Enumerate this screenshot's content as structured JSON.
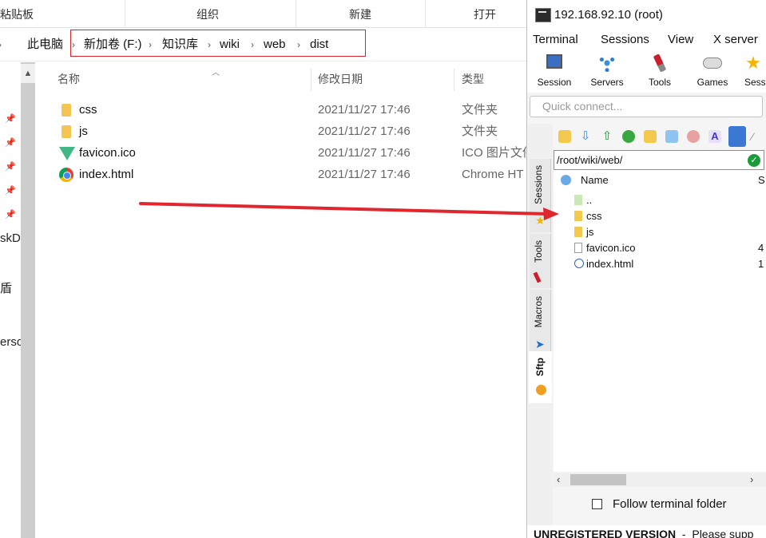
{
  "explorer": {
    "ribbon": {
      "groups": [
        "粘贴板",
        "组织",
        "新建",
        "打开"
      ]
    },
    "breadcrumb": {
      "items": [
        "此电脑",
        "新加卷 (F:)",
        "知识库",
        "wiki",
        "web",
        "dist"
      ]
    },
    "nav_fragments": [
      "skDe",
      "盾",
      "erso"
    ],
    "columns": {
      "name": "名称",
      "modified": "修改日期",
      "type": "类型"
    },
    "files": [
      {
        "name": "css",
        "date": "2021/11/27 17:46",
        "type": "文件夹",
        "icon": "folder-icon"
      },
      {
        "name": "js",
        "date": "2021/11/27 17:46",
        "type": "文件夹",
        "icon": "folder-icon"
      },
      {
        "name": "favicon.ico",
        "date": "2021/11/27 17:46",
        "type": "ICO 图片文件",
        "icon": "vue-icon"
      },
      {
        "name": "index.html",
        "date": "2021/11/27 17:46",
        "type": "Chrome HT",
        "icon": "chrome-icon"
      }
    ]
  },
  "moba": {
    "title": "192.168.92.10 (root)",
    "menu": [
      "Terminal",
      "Sessions",
      "View",
      "X server"
    ],
    "toolbar": [
      {
        "label": "Session",
        "icon": "session-icon"
      },
      {
        "label": "Servers",
        "icon": "servers-icon"
      },
      {
        "label": "Tools",
        "icon": "tools-icon"
      },
      {
        "label": "Games",
        "icon": "games-icon"
      },
      {
        "label": "Sess",
        "icon": "star-icon"
      }
    ],
    "quick_connect_placeholder": "Quick connect...",
    "side_tabs": {
      "sessions": "Sessions",
      "tools": "Tools",
      "macros": "Macros",
      "sftp": "Sftp"
    },
    "sftp": {
      "path": "/root/wiki/web/",
      "columns": {
        "name": "Name",
        "size": "S"
      },
      "entries": [
        {
          "name": "..",
          "size": "",
          "icon": "parent-folder-icon"
        },
        {
          "name": "css",
          "size": "",
          "icon": "folder-icon"
        },
        {
          "name": "js",
          "size": "",
          "icon": "folder-icon"
        },
        {
          "name": "favicon.ico",
          "size": "4",
          "icon": "file-icon"
        },
        {
          "name": "index.html",
          "size": "1",
          "icon": "html-file-icon"
        }
      ],
      "follow_terminal_label": "Follow terminal folder",
      "follow_terminal_checked": false
    },
    "footer": {
      "bold": "UNREGISTERED VERSION",
      "rest": "  -  Please supp"
    }
  },
  "colors": {
    "highlight_border": "#d9242e",
    "arrow": "#e0262f",
    "moba_accent": "#1e6fd0"
  }
}
